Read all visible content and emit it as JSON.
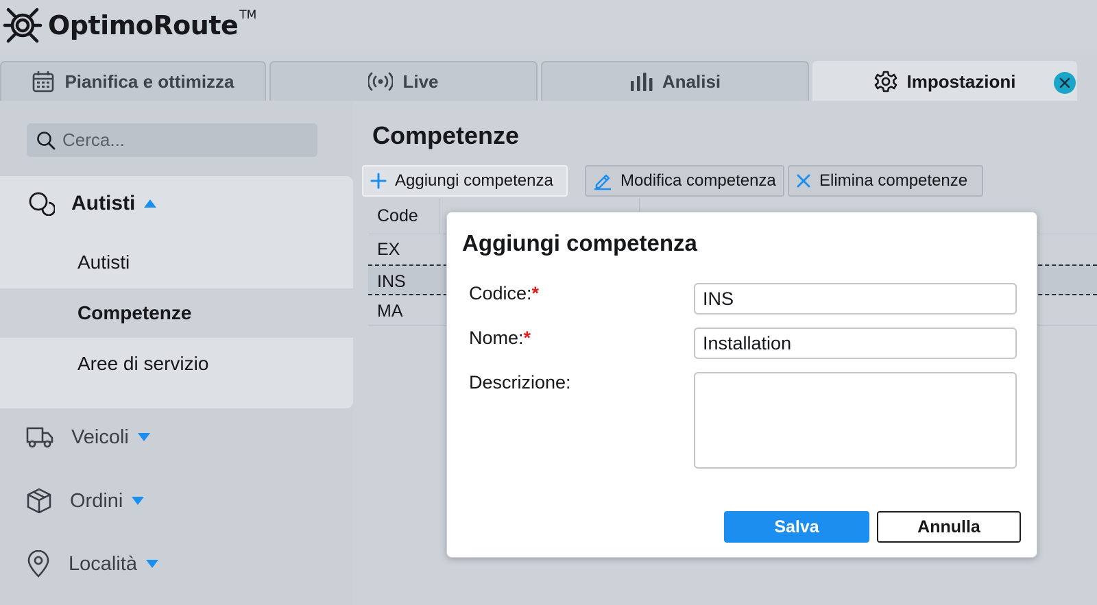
{
  "app": {
    "logo_text": "OptimoRoute",
    "logo_tm": "TM",
    "logo_icon": "optimoroute-logo-icon"
  },
  "tabs": [
    {
      "label": "Pianifica e ottimizza",
      "icon": "calendar-icon",
      "active": false
    },
    {
      "label": "Live",
      "icon": "broadcast-icon",
      "active": false
    },
    {
      "label": "Analisi",
      "icon": "bar-chart-icon",
      "active": false
    },
    {
      "label": "Impostazioni",
      "icon": "gear-icon",
      "active": true
    }
  ],
  "sidebar": {
    "search_placeholder": "Cerca...",
    "group": {
      "label": "Autisti",
      "icon": "drivers-icon",
      "expanded": true,
      "items": [
        {
          "label": "Autisti",
          "active": false
        },
        {
          "label": "Competenze",
          "active": true
        },
        {
          "label": "Aree di servizio",
          "active": false
        }
      ]
    },
    "nav": [
      {
        "label": "Veicoli",
        "icon": "truck-icon"
      },
      {
        "label": "Ordini",
        "icon": "package-icon"
      },
      {
        "label": "Località",
        "icon": "location-pin-icon"
      }
    ]
  },
  "main": {
    "title": "Competenze",
    "toolbar": {
      "add_label": "Aggiungi competenza",
      "edit_label": "Modifica competenza",
      "delete_label": "Elimina competenze"
    },
    "table": {
      "columns": [
        "Code"
      ],
      "rows": [
        "EX",
        "INS",
        "MA"
      ],
      "selected_row": "INS"
    }
  },
  "dialog": {
    "title": "Aggiungi competenza",
    "fields": {
      "code_label": "Codice:",
      "code_value": "INS",
      "name_label": "Nome:",
      "name_value": "Installation",
      "description_label": "Descrizione:",
      "description_value": ""
    },
    "required_marker": "*",
    "save_label": "Salva",
    "cancel_label": "Annulla"
  },
  "colors": {
    "accent": "#1b8ef0",
    "close_badge": "#1ba5c8",
    "required": "#e0201d"
  }
}
